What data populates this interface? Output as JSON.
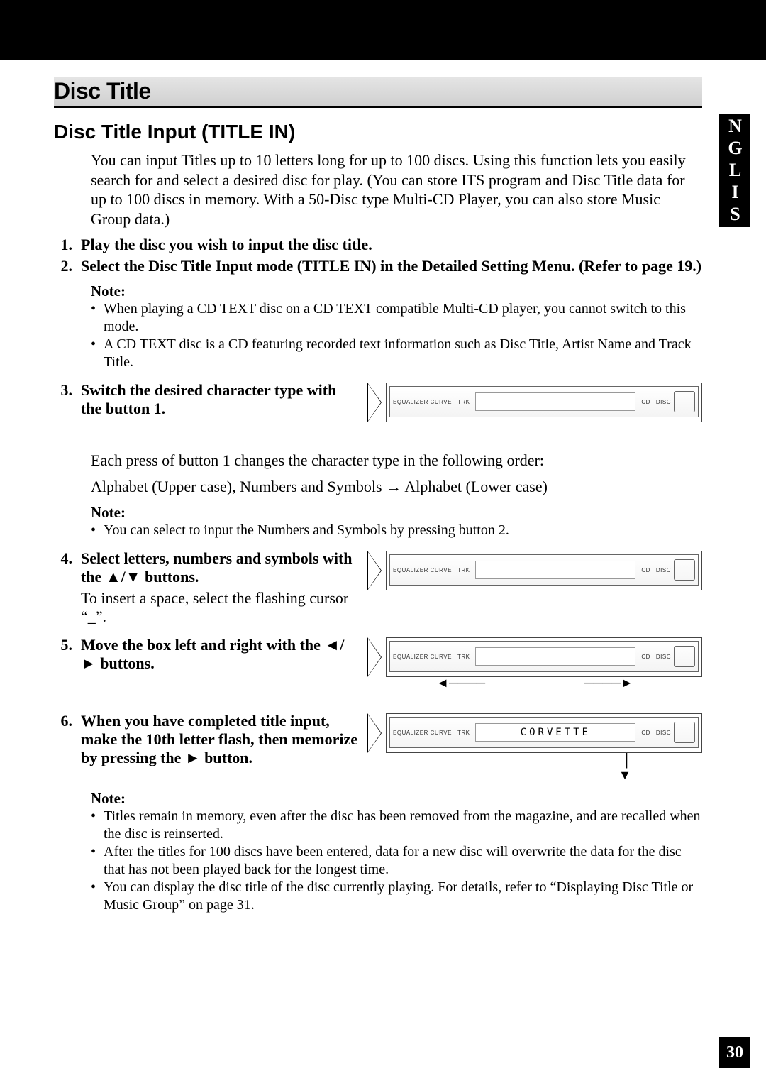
{
  "lang_tab": "ENGLISH",
  "page_number": "30",
  "section_title": "Disc Title",
  "subsection_title": "Disc Title Input (TITLE IN)",
  "intro": "You can input Titles up to 10 letters long for up to 100 discs. Using this function lets you easily search for and select a desired disc for play. (You can store ITS program and Disc Title data for up to 100 discs in memory. With a 50-Disc type Multi-CD Player, you can also store Music Group data.)",
  "steps": {
    "s1_num": "1.",
    "s1": "Play the disc you wish to input the disc title.",
    "s2_num": "2.",
    "s2": "Select the Disc Title Input mode (TITLE IN) in the Detailed Setting Menu. (Refer to page 19.)",
    "s3_num": "3.",
    "s3": "Switch the desired character type with the button 1.",
    "s3_follow1": "Each press of button 1 changes the character type in the following order:",
    "s3_follow2": "Alphabet (Upper case), Numbers and Symbols → Alphabet (Lower case)",
    "s4_num": "4.",
    "s4": "Select letters, numbers and symbols with the ▲/▼ buttons.",
    "s4_sub": "To insert a space, select the flashing cursor “_”.",
    "s5_num": "5.",
    "s5": "Move the box left and right with the ◄/► buttons.",
    "s6_num": "6.",
    "s6": "When you have completed title input, make the 10th letter flash, then memorize by pressing the ► button."
  },
  "note_label": "Note:",
  "notes1": {
    "n1": "When playing a CD TEXT disc on a CD TEXT compatible Multi-CD player, you cannot switch to this mode.",
    "n2": "A CD TEXT disc is a CD featuring recorded text information such as Disc Title, Artist Name and Track Title."
  },
  "notes2": {
    "n1": "You can select to input the Numbers and Symbols by pressing button 2."
  },
  "notes3": {
    "n1": "Titles remain in memory, even after the disc has been removed from the magazine, and are recalled when the disc is reinserted.",
    "n2": "After the titles for 100 discs have been entered, data for a new disc will overwrite the data for the disc that has not been played back for the longest time.",
    "n3": "You can display the disc title of the disc currently playing. For details, refer to “Displaying Disc Title or Music Group” on page 31."
  },
  "device": {
    "eq_label": "EQUALIZER CURVE",
    "trk_label": "TRK",
    "cd_label": "CD",
    "disc_label": "DISC",
    "display_step3": "",
    "display_step4": "",
    "display_step5": "",
    "display_step6": "CORVETTE"
  }
}
